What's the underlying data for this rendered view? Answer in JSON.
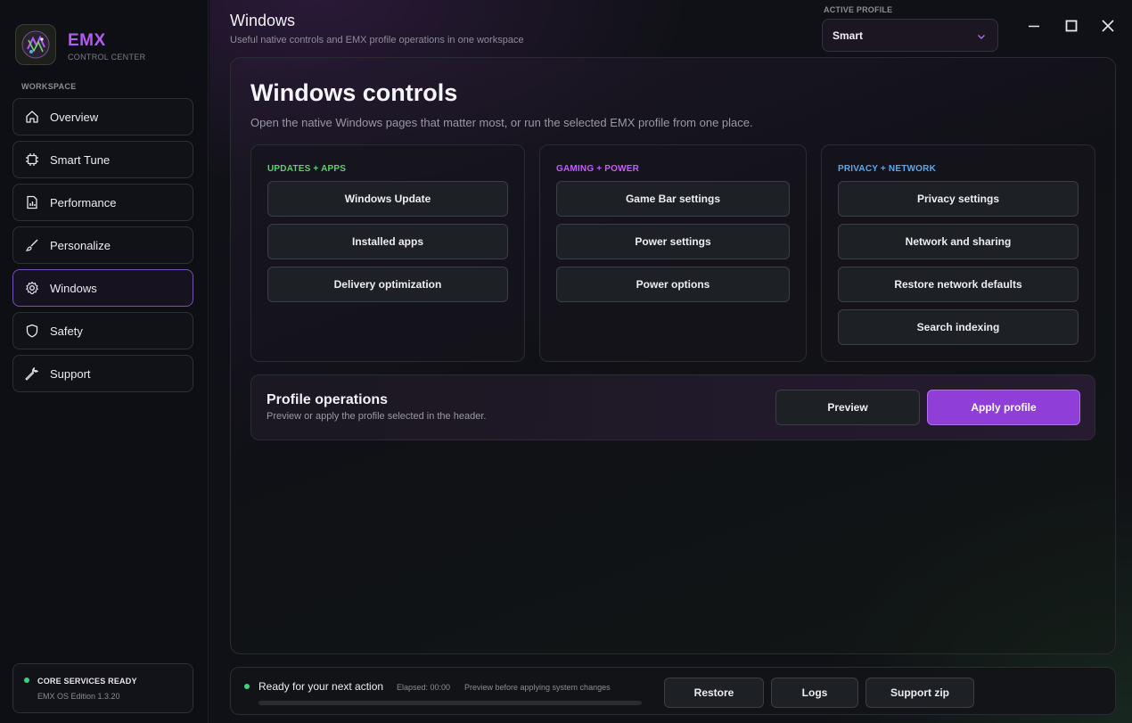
{
  "brand": {
    "name": "EMX",
    "subtitle": "CONTROL CENTER"
  },
  "sidebar": {
    "section_label": "WORKSPACE",
    "items": [
      {
        "label": "Overview",
        "icon": "home-icon",
        "active": false
      },
      {
        "label": "Smart Tune",
        "icon": "chip-icon",
        "active": false
      },
      {
        "label": "Performance",
        "icon": "chart-file-icon",
        "active": false
      },
      {
        "label": "Personalize",
        "icon": "brush-icon",
        "active": false
      },
      {
        "label": "Windows",
        "icon": "gear-icon",
        "active": true
      },
      {
        "label": "Safety",
        "icon": "shield-icon",
        "active": false
      },
      {
        "label": "Support",
        "icon": "wrench-icon",
        "active": false
      }
    ],
    "status": {
      "title": "CORE SERVICES READY",
      "version": "EMX OS Edition 1.3.20",
      "color": "#37d67a"
    }
  },
  "header": {
    "title": "Windows",
    "subtitle": "Useful native controls and EMX profile operations in one workspace",
    "profile_label": "ACTIVE PROFILE",
    "profile_value": "Smart"
  },
  "window_controls": {
    "minimize": "minimize-icon",
    "maximize": "maximize-icon",
    "close": "close-icon"
  },
  "main": {
    "title": "Windows controls",
    "subtitle": "Open the native Windows pages that matter most, or run the selected EMX profile from one place.",
    "groups": [
      {
        "title": "UPDATES + APPS",
        "color": "#5fd06a",
        "buttons": [
          "Windows Update",
          "Installed apps",
          "Delivery optimization"
        ]
      },
      {
        "title": "GAMING + POWER",
        "color": "#c060f0",
        "buttons": [
          "Game Bar settings",
          "Power settings",
          "Power options"
        ]
      },
      {
        "title": "PRIVACY + NETWORK",
        "color": "#5aa8f0",
        "buttons": [
          "Privacy settings",
          "Network and sharing",
          "Restore network defaults",
          "Search indexing"
        ]
      }
    ],
    "profile_ops": {
      "title": "Profile operations",
      "subtitle": "Preview or apply the profile selected in the header.",
      "preview_label": "Preview",
      "apply_label": "Apply profile"
    }
  },
  "footer": {
    "status": "Ready for your next action",
    "elapsed": "Elapsed: 00:00",
    "hint": "Preview before applying system changes",
    "progress": 0,
    "buttons": [
      "Restore",
      "Logs",
      "Support zip"
    ]
  },
  "colors": {
    "accent": "#8f3fd8",
    "brand": "#b45cf2",
    "ready": "#37d67a"
  }
}
